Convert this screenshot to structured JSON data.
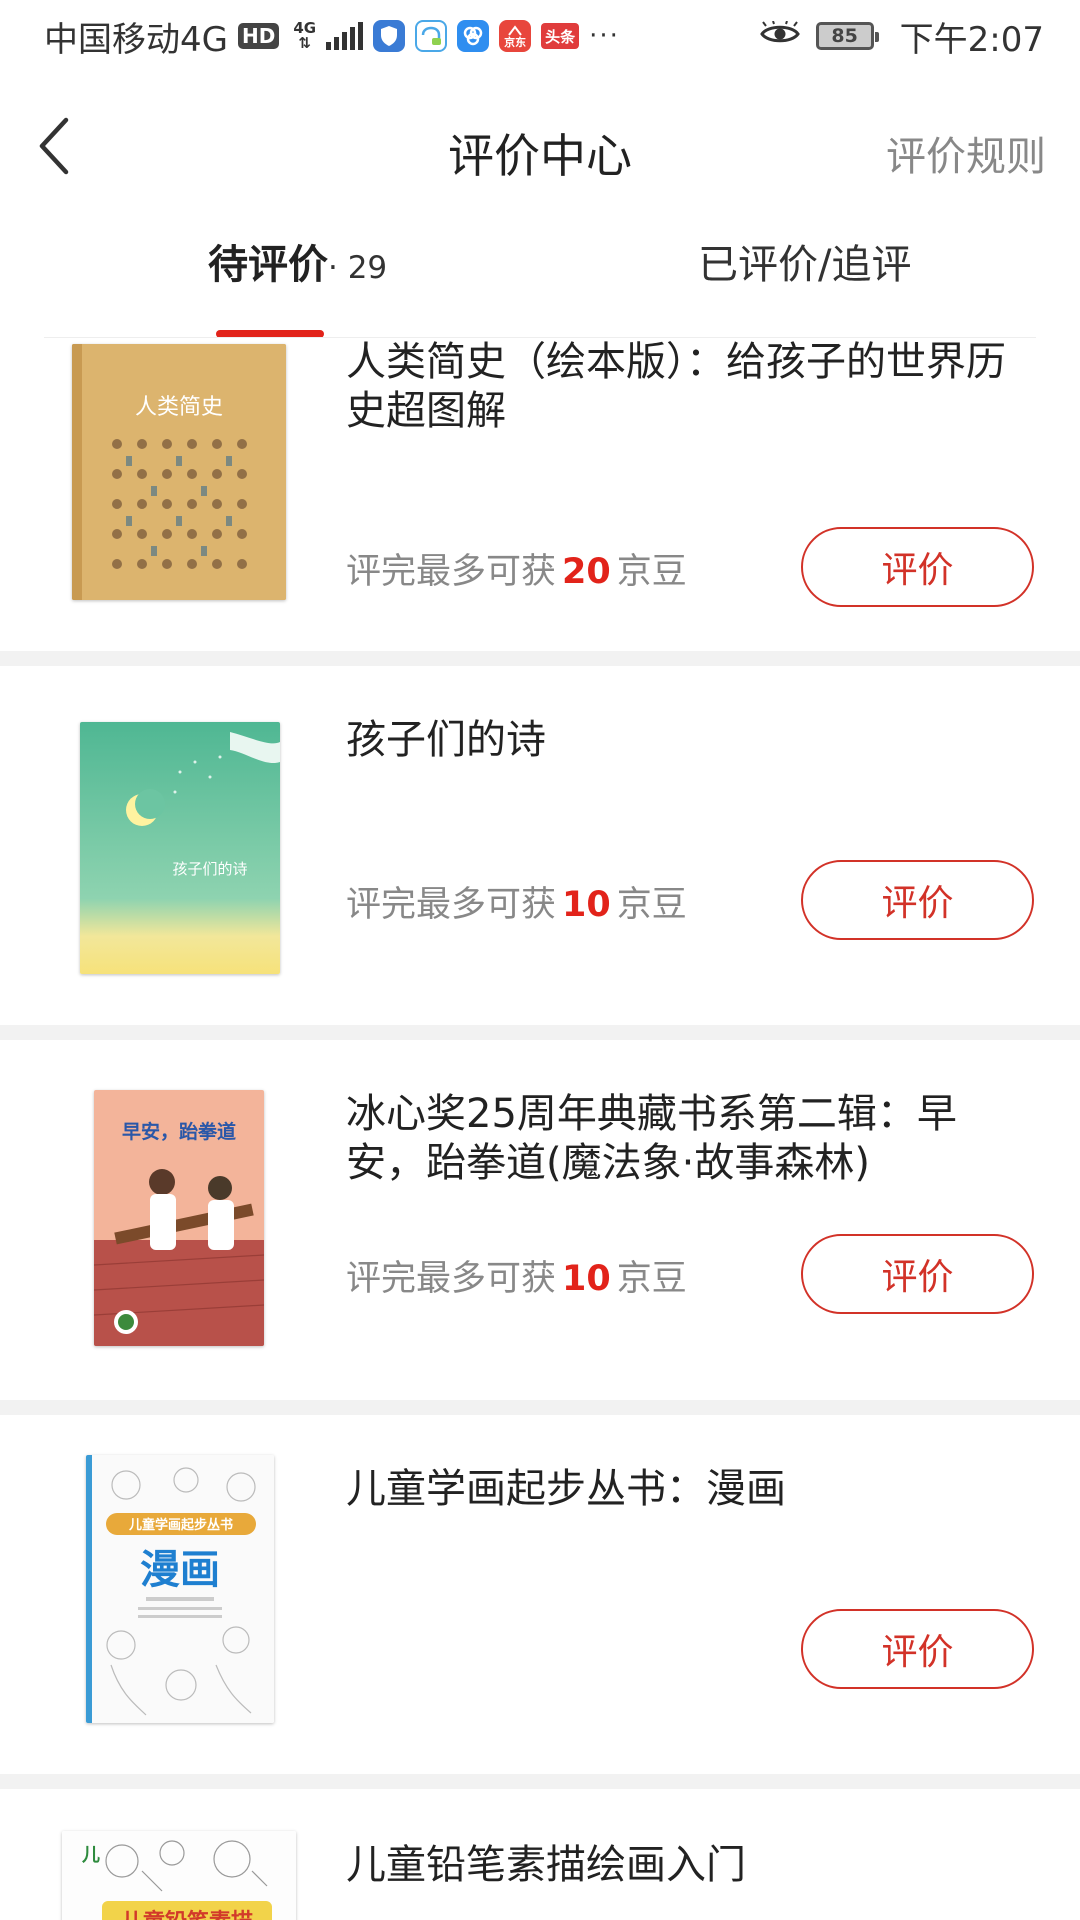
{
  "status": {
    "carrier": "中国移动4G",
    "hd": "HD",
    "net_type": "4G",
    "apps": [
      "shield-app-icon",
      "chat-app-icon",
      "link-app-icon",
      "jd-app-icon"
    ],
    "jd_label": "京东",
    "toutiao_label": "头条",
    "more": "···",
    "battery": "85",
    "time": "下午2:07"
  },
  "nav": {
    "title": "评价中心",
    "rules": "评价规则"
  },
  "tabs": {
    "pending_label": "待评价",
    "pending_count": "· 29",
    "done_label": "已评价/追评"
  },
  "items": [
    {
      "title": "人类简史（绘本版）：给孩子的世界历史超图解",
      "reward_prefix": "评完最多可获",
      "reward_num": "20",
      "reward_suffix": "京豆",
      "button": "评价",
      "cover_title": "人类简史"
    },
    {
      "title": "孩子们的诗",
      "reward_prefix": "评完最多可获",
      "reward_num": "10",
      "reward_suffix": "京豆",
      "button": "评价",
      "cover_title": "孩子们的诗"
    },
    {
      "title": "冰心奖25周年典藏书系第二辑：早安，跆拳道(魔法象·故事森林)",
      "reward_prefix": "评完最多可获",
      "reward_num": "10",
      "reward_suffix": "京豆",
      "button": "评价",
      "cover_title": "早安，跆拳道"
    },
    {
      "title": "儿童学画起步丛书：漫画",
      "button": "评价",
      "cover_series": "儿童学画起步丛书",
      "cover_title": "漫画"
    },
    {
      "title": "儿童铅笔素描绘画入门",
      "cover_title": "儿童铅笔素描"
    }
  ],
  "colors": {
    "accent": "#e2231a",
    "button_border": "#d23228",
    "muted": "#888888",
    "separator": "#f2f2f2"
  }
}
